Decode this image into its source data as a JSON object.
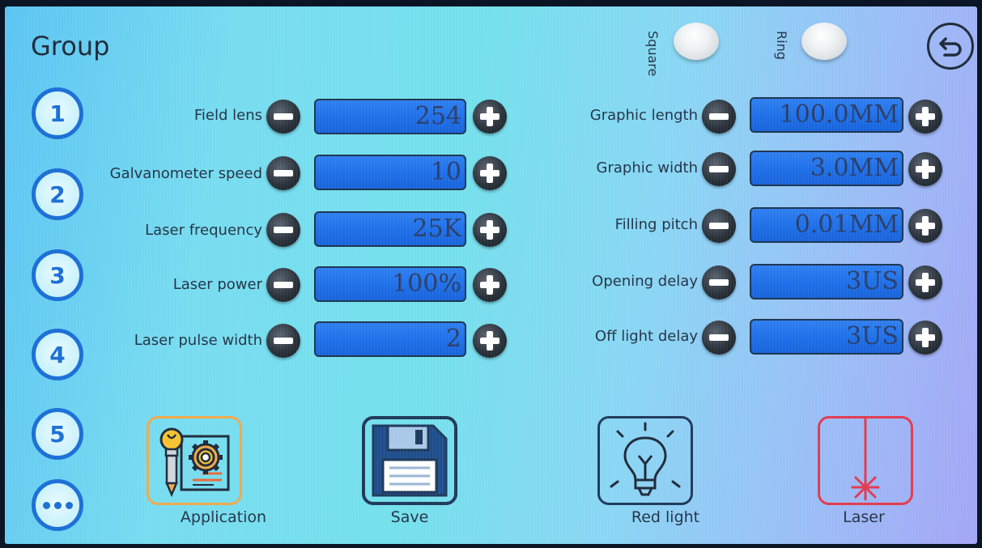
{
  "header": {
    "title": "Group"
  },
  "toggles": {
    "square_label": "Square",
    "ring_label": "Ring"
  },
  "groups": [
    "1",
    "2",
    "3",
    "4",
    "5"
  ],
  "left_params": [
    {
      "label": "Field lens",
      "value": "254"
    },
    {
      "label": "Galvanometer speed",
      "value": "10"
    },
    {
      "label": "Laser frequency",
      "value": "25K"
    },
    {
      "label": "Laser power",
      "value": "100%"
    },
    {
      "label": "Laser pulse width",
      "value": "2"
    }
  ],
  "right_params": [
    {
      "label": "Graphic length",
      "value": "100.0MM"
    },
    {
      "label": "Graphic width",
      "value": "3.0MM"
    },
    {
      "label": "Filling pitch",
      "value": "0.01MM"
    },
    {
      "label": "Opening delay",
      "value": "3US"
    },
    {
      "label": "Off light delay",
      "value": "3US"
    }
  ],
  "tools": {
    "application_label": "Application",
    "save_label": "Save",
    "red_light_label": "Red light",
    "laser_label": "Laser"
  },
  "icons": {
    "back": "back-arrow-icon",
    "more": "more-dots-icon",
    "application": "application-settings-icon",
    "save": "floppy-disk-icon",
    "red_light": "light-bulb-icon",
    "laser": "laser-icon"
  },
  "colors": {
    "accent_blue": "#1b6fd6",
    "value_box": "#1e6fe8",
    "laser_red": "#e23b4e",
    "application_orange": "#f0a94a"
  }
}
